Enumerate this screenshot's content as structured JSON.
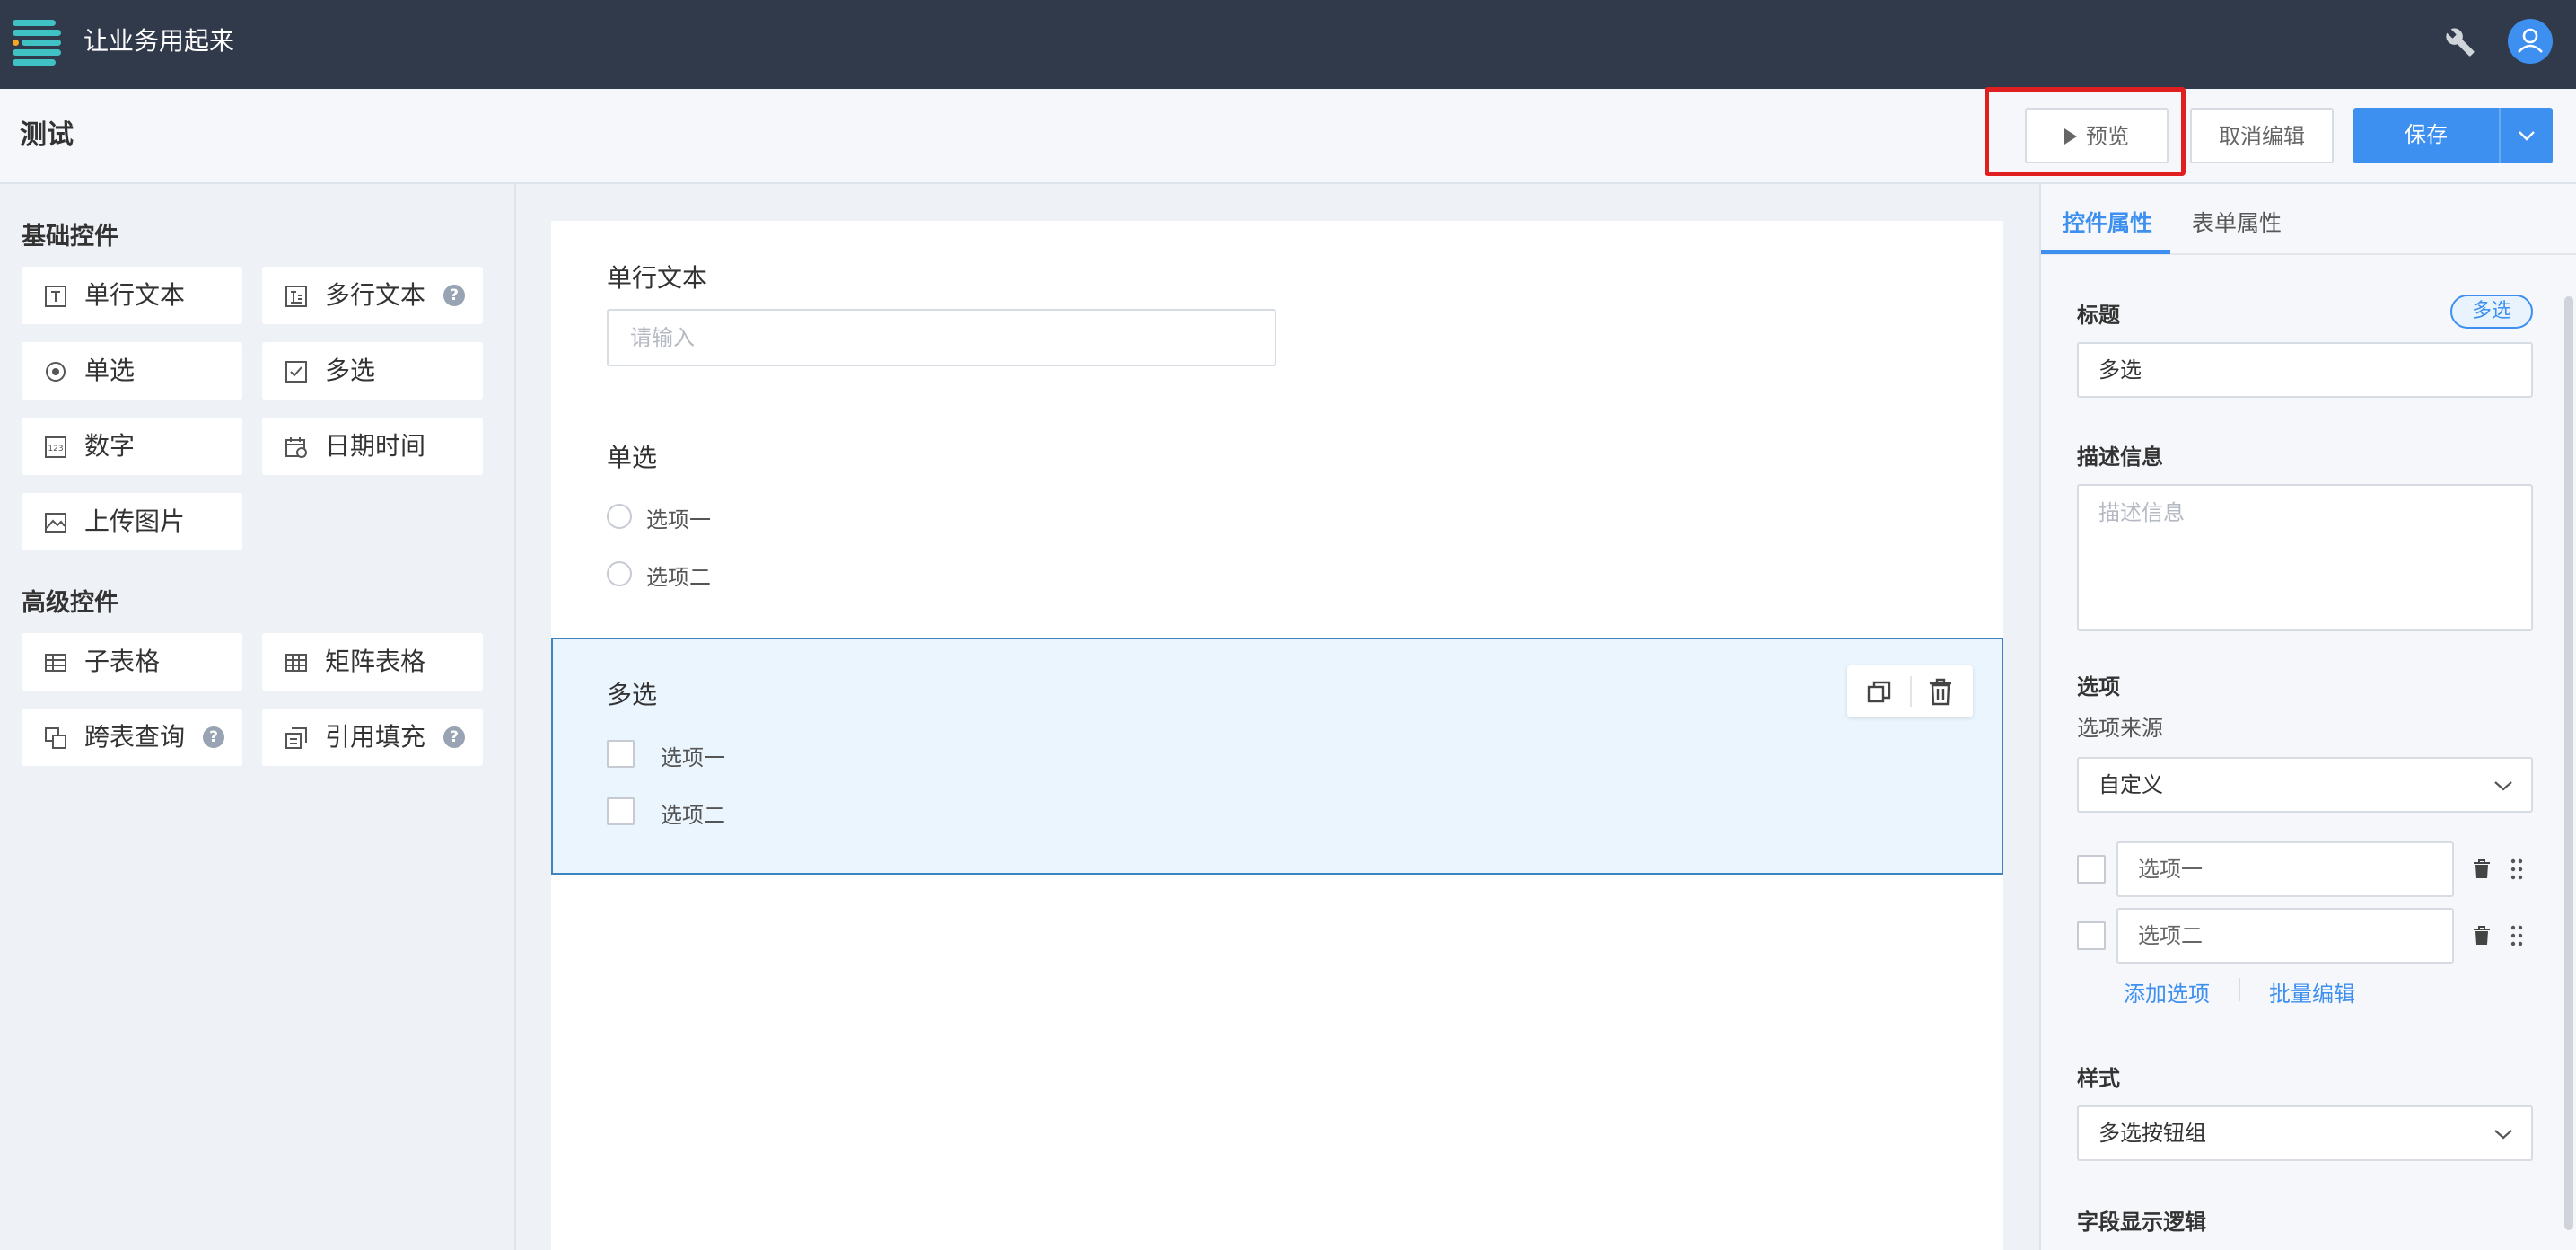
{
  "app": {
    "title": "让业务用起来",
    "wrench_icon": "wrench-icon",
    "avatar_icon": "user-avatar-icon"
  },
  "toolbar": {
    "page_title": "测试",
    "preview_label": "预览",
    "cancel_label": "取消编辑",
    "save_label": "保存"
  },
  "left": {
    "basic_title": "基础控件",
    "advanced_title": "高级控件",
    "basic_controls": [
      {
        "label": "单行文本",
        "icon": "single-line-text-icon"
      },
      {
        "label": "多行文本",
        "icon": "multi-line-text-icon",
        "help": true
      },
      {
        "label": "单选",
        "icon": "radio-icon"
      },
      {
        "label": "多选",
        "icon": "checkbox-icon"
      },
      {
        "label": "数字",
        "icon": "number-icon"
      },
      {
        "label": "日期时间",
        "icon": "calendar-icon"
      },
      {
        "label": "上传图片",
        "icon": "image-icon"
      }
    ],
    "advanced_controls": [
      {
        "label": "子表格",
        "icon": "subtable-icon"
      },
      {
        "label": "矩阵表格",
        "icon": "matrix-table-icon"
      },
      {
        "label": "跨表查询",
        "icon": "cross-query-icon",
        "help": true
      },
      {
        "label": "引用填充",
        "icon": "reference-fill-icon",
        "help": true
      }
    ],
    "help_glyph": "?"
  },
  "form": {
    "field1": {
      "label": "单行文本",
      "placeholder": "请输入"
    },
    "field2": {
      "label": "单选",
      "options": [
        "选项一",
        "选项二"
      ]
    },
    "field3": {
      "label": "多选",
      "options": [
        "选项一",
        "选项二"
      ]
    }
  },
  "props": {
    "tab_control": "控件属性",
    "tab_form": "表单属性",
    "title_label": "标题",
    "title_tag": "多选",
    "title_value": "多选",
    "desc_label": "描述信息",
    "desc_placeholder": "描述信息",
    "options_label": "选项",
    "source_label": "选项来源",
    "source_value": "自定义",
    "options": [
      "选项一",
      "选项二"
    ],
    "add_option": "添加选项",
    "batch_edit": "批量编辑",
    "style_label": "样式",
    "style_value": "多选按钮组",
    "logic_label": "字段显示逻辑"
  },
  "colors": {
    "topbar": "#313a4b",
    "accent": "#3d8ff0",
    "highlight": "#e02020",
    "selected_bg": "#eaf5fd"
  }
}
